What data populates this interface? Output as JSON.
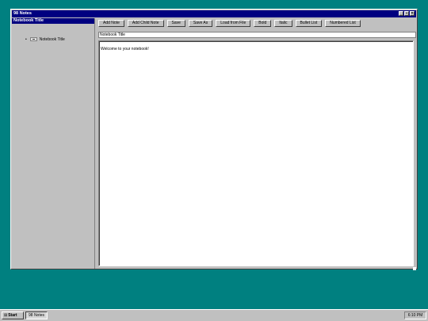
{
  "window": {
    "title": "98 Notes",
    "controls": {
      "minimize": "_",
      "maximize": "▪",
      "close": "×"
    }
  },
  "sidebar": {
    "header": "Notebook Title",
    "items": [
      {
        "label": "Notebook Title",
        "bullet": "•",
        "icon": "note-icon"
      }
    ]
  },
  "toolbar": {
    "buttons": [
      "Add Note",
      "Add Child Note",
      "Save",
      "Save As",
      "Load from File",
      "Bold",
      "Italic",
      "Bullet List",
      "Numbered List"
    ]
  },
  "editor": {
    "title_value": "Notebook Title",
    "content": "Welcome to your notebook!"
  },
  "taskbar": {
    "start_label": "Start",
    "start_icon": "windows-logo-icon",
    "task_label": "98 Notes",
    "clock": "6:10 PM"
  },
  "colors": {
    "desktop": "#008080",
    "titlebar": "#000080",
    "face": "#c0c0c0"
  }
}
